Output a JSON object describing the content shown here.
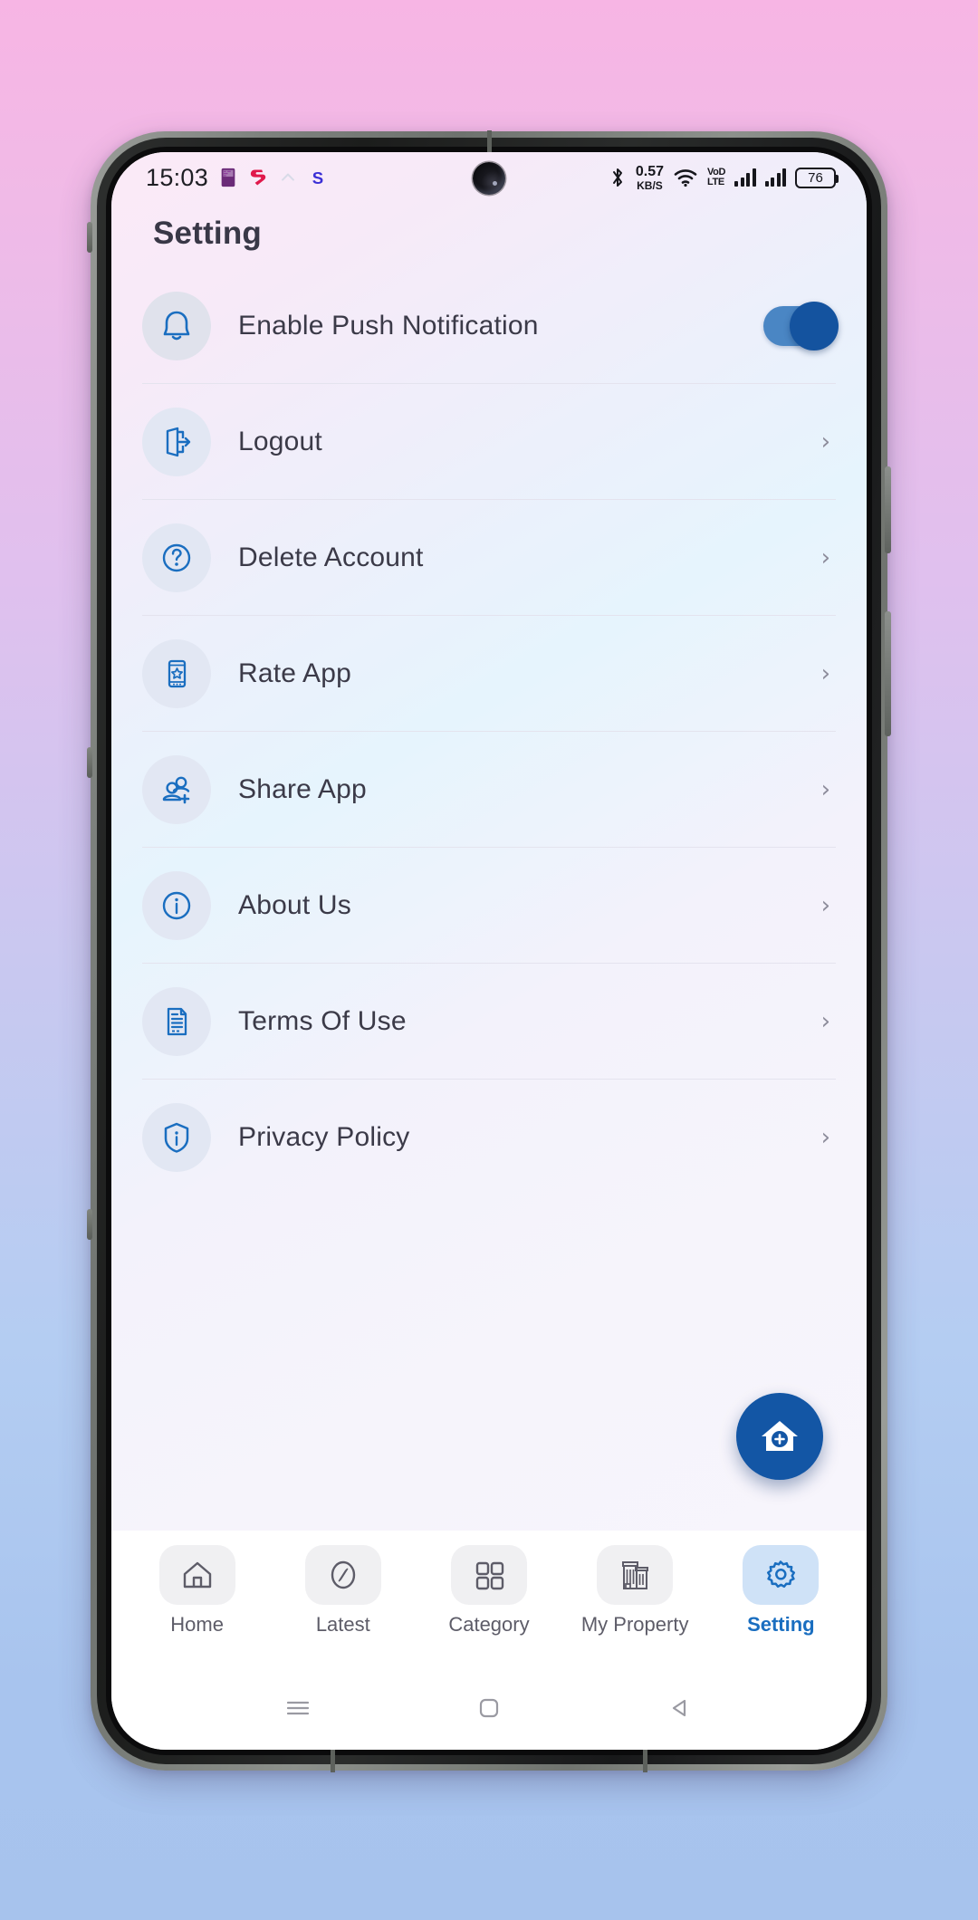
{
  "status_bar": {
    "time": "15:03",
    "left_icons": [
      "sim-card-icon",
      "app-notification-icon",
      "chevron-up-icon",
      "s-app-icon"
    ],
    "network_speed_value": "0.57",
    "network_speed_unit": "KB/S",
    "volte_line1": "VoD",
    "volte_line2": "LTE",
    "battery_percent": "76",
    "right_icons": [
      "bluetooth-icon",
      "wifi-icon",
      "volte-icon",
      "signal-icon",
      "signal-icon",
      "battery-icon"
    ]
  },
  "header": {
    "title": "Setting"
  },
  "settings": {
    "rows": [
      {
        "label": "Enable Push Notification",
        "icon": "bell-icon",
        "control": "toggle",
        "toggle_on": true
      },
      {
        "label": "Logout",
        "icon": "logout-icon",
        "control": "chevron",
        "chevron": "›"
      },
      {
        "label": "Delete Account",
        "icon": "question-circle-icon",
        "control": "chevron",
        "chevron": "›"
      },
      {
        "label": "Rate App",
        "icon": "phone-star-icon",
        "control": "chevron",
        "chevron": "›"
      },
      {
        "label": "Share App",
        "icon": "add-user-icon",
        "control": "chevron",
        "chevron": "›"
      },
      {
        "label": "About Us",
        "icon": "info-circle-icon",
        "control": "chevron",
        "chevron": "›"
      },
      {
        "label": "Terms Of Use",
        "icon": "document-icon",
        "control": "chevron",
        "chevron": "›"
      },
      {
        "label": "Privacy Policy",
        "icon": "shield-info-icon",
        "control": "chevron",
        "chevron": "›"
      }
    ]
  },
  "fab": {
    "icon": "add-property-home-icon"
  },
  "bottom_nav": {
    "items": [
      {
        "label": "Home",
        "icon": "home-icon",
        "active": false
      },
      {
        "label": "Latest",
        "icon": "compass-icon",
        "active": false
      },
      {
        "label": "Category",
        "icon": "grid-icon",
        "active": false
      },
      {
        "label": "My Property",
        "icon": "buildings-icon",
        "active": false
      },
      {
        "label": "Setting",
        "icon": "gear-icon",
        "active": true
      }
    ]
  },
  "system_nav": {
    "buttons": [
      "recents-icon",
      "home-square-icon",
      "back-triangle-icon"
    ]
  },
  "colors": {
    "accent": "#1356a5",
    "icon_blue": "#1a6ec0",
    "icon_bg": "#e2e7f3",
    "text": "#3b3a48",
    "toggle_track": "#4a86c4",
    "toggle_knob": "#14539f"
  }
}
